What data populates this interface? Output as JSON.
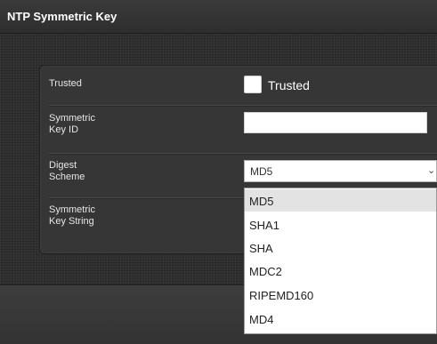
{
  "window": {
    "title": "NTP Symmetric Key"
  },
  "form": {
    "trusted": {
      "label": "Trusted",
      "checkbox_label": "Trusted",
      "checked": false
    },
    "key_id": {
      "label": "Symmetric\nKey ID",
      "value": ""
    },
    "digest": {
      "label": "Digest\nScheme",
      "selected": "MD5"
    },
    "key_string": {
      "label": "Symmetric\nKey String"
    }
  },
  "dropdown": {
    "options": [
      "MD5",
      "SHA1",
      "SHA",
      "MDC2",
      "RIPEMD160",
      "MD4"
    ],
    "highlighted": "MD5"
  },
  "colors": {
    "background": "#2b2b2b",
    "panel": "#363636",
    "highlight": "#e3e3e3"
  },
  "icons": {
    "select_arrow": "chevron-down-icon"
  }
}
